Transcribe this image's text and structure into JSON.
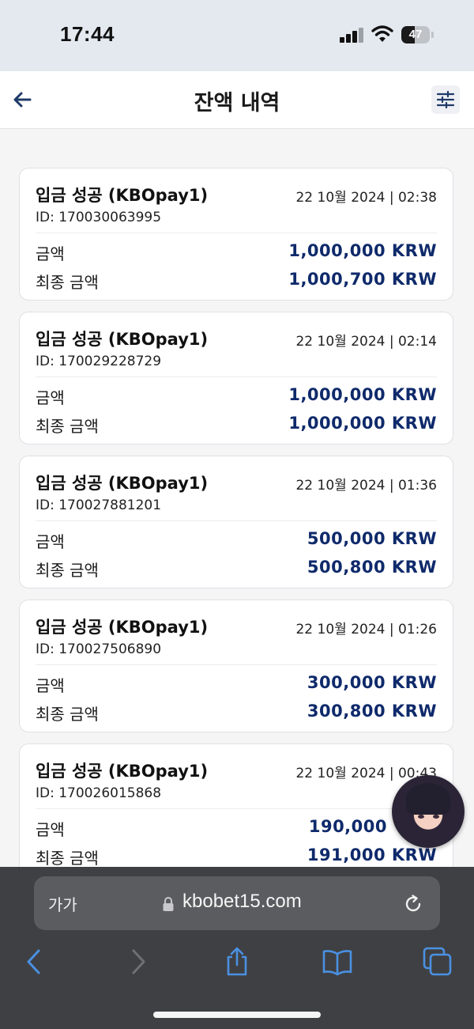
{
  "status_bar": {
    "time": "17:44",
    "battery": "47",
    "battery_level": 0.47
  },
  "header": {
    "title": "잔액 내역"
  },
  "transactions": [
    {
      "title": "입금 성공 (KBOpay1)",
      "date": "22 10월 2024 | 02:38",
      "id": "ID: 170030063995",
      "amount_label": "금액",
      "amount": "1,000,000 KRW",
      "final_label": "최종 금액",
      "final_amount": "1,000,700 KRW"
    },
    {
      "title": "입금 성공 (KBOpay1)",
      "date": "22 10월 2024 | 02:14",
      "id": "ID: 170029228729",
      "amount_label": "금액",
      "amount": "1,000,000 KRW",
      "final_label": "최종 금액",
      "final_amount": "1,000,000 KRW"
    },
    {
      "title": "입금 성공 (KBOpay1)",
      "date": "22 10월 2024 | 01:36",
      "id": "ID: 170027881201",
      "amount_label": "금액",
      "amount": "500,000 KRW",
      "final_label": "최종 금액",
      "final_amount": "500,800 KRW"
    },
    {
      "title": "입금 성공 (KBOpay1)",
      "date": "22 10월 2024 | 01:26",
      "id": "ID: 170027506890",
      "amount_label": "금액",
      "amount": "300,000 KRW",
      "final_label": "최종 금액",
      "final_amount": "300,800 KRW"
    },
    {
      "title": "입금 성공 (KBOpay1)",
      "date": "22 10월 2024 | 00:43",
      "id": "ID: 170026015868",
      "amount_label": "금액",
      "amount": "190,000",
      "final_label": "최종 금액",
      "final_amount": "191,000 KRW"
    }
  ],
  "browser": {
    "text_size_button": "가가",
    "url": "kbobet15.com"
  },
  "colors": {
    "amount": "#0f2a6b",
    "accent": "#4a90e2",
    "header_bg": "#ffffff",
    "browser_bg": "#3f4043"
  },
  "icons": [
    "back-arrow-icon",
    "filter-sliders-icon",
    "lock-icon",
    "reload-icon",
    "chevron-left-icon",
    "chevron-right-icon",
    "share-icon",
    "bookmarks-book-icon",
    "tabs-icon"
  ]
}
